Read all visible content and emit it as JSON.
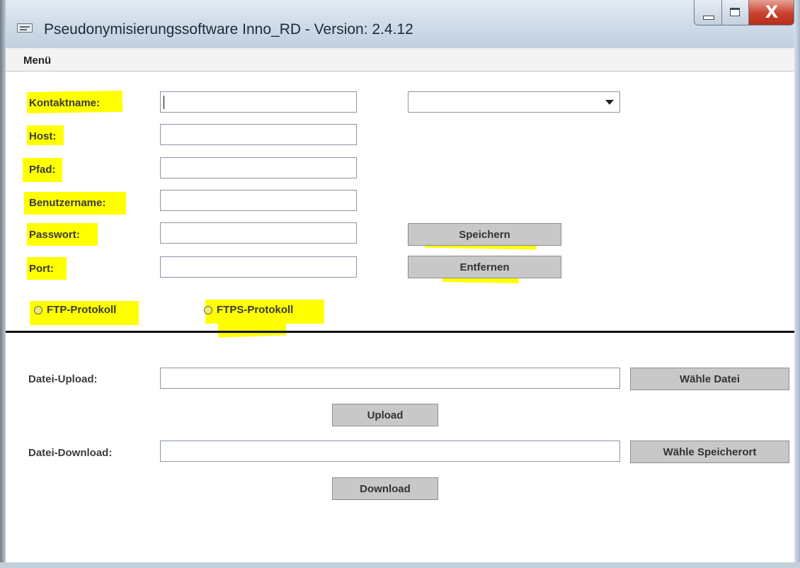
{
  "window": {
    "title": "Pseudonymisierungssoftware Inno_RD - Version: 2.4.12",
    "close_glyph": "X"
  },
  "menu": {
    "label": "Menü"
  },
  "form": {
    "contact_name_label": "Kontaktname:",
    "host_label": "Host:",
    "path_label": "Pfad:",
    "username_label": "Benutzername:",
    "password_label": "Passwort:",
    "port_label": "Port:",
    "contact_name_value": "",
    "host_value": "",
    "path_value": "",
    "username_value": "",
    "password_value": "",
    "port_value": "",
    "contact_select_value": "",
    "save_button": "Speichern",
    "remove_button": "Entfernen",
    "ftp_option": "FTP-Protokoll",
    "ftps_option": "FTPS-Protokoll"
  },
  "transfer": {
    "upload_label": "Datei-Upload:",
    "upload_path_value": "",
    "choose_file_button": "Wähle Datei",
    "upload_button": "Upload",
    "download_label": "Datei-Download:",
    "download_path_value": "",
    "choose_location_button": "Wähle Speicherort",
    "download_button": "Download"
  },
  "colors": {
    "highlight": "#ffff00",
    "button_face": "#c8c8c8",
    "close_button": "#c8412c"
  },
  "icons": [
    "app-icon",
    "minimize-icon",
    "maximize-icon",
    "close-icon",
    "dropdown-arrow-icon",
    "radio-icon"
  ]
}
